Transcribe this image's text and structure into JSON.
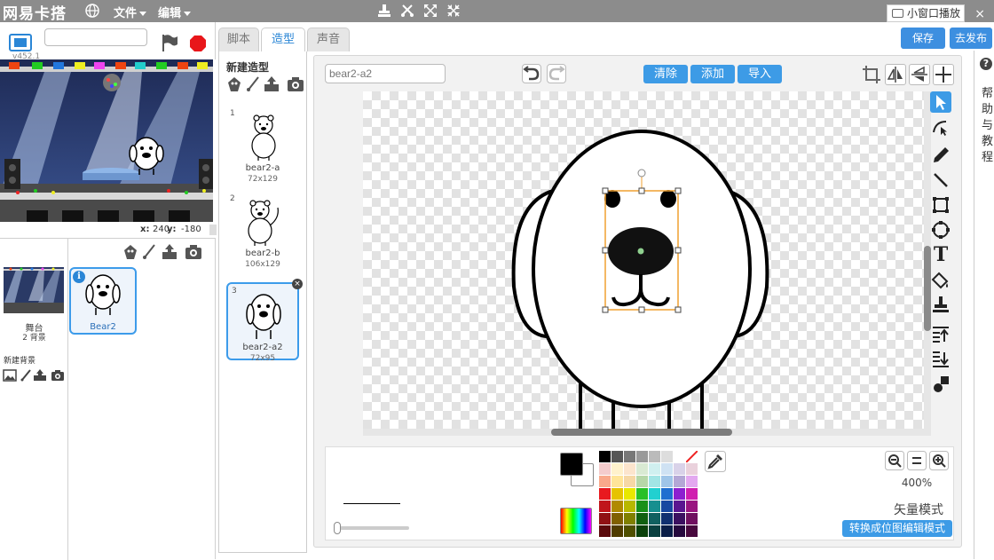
{
  "topbar": {
    "logo": "网易卡搭",
    "menus": [
      "文件",
      "编辑"
    ],
    "small_window": "小窗口播放",
    "close": "×"
  },
  "actions": {
    "save": "保存",
    "publish": "去发布"
  },
  "stage": {
    "version": "v452.1",
    "x_label": "x:",
    "x_value": "240",
    "y_label": "y:",
    "y_value": "-180"
  },
  "sprites": {
    "stage_name": "舞台",
    "bg_count": "2 背景",
    "new_bg_label": "新建背景",
    "items": [
      {
        "name": "Bear2",
        "info": "i"
      }
    ]
  },
  "tabs": [
    "脚本",
    "造型",
    "声音"
  ],
  "costumes": {
    "new_label": "新建造型",
    "items": [
      {
        "num": "1",
        "name": "bear2-a",
        "size": "72x129"
      },
      {
        "num": "2",
        "name": "bear2-b",
        "size": "106x129"
      },
      {
        "num": "3",
        "name": "bear2-a2",
        "size": "72x95"
      }
    ],
    "delete_glyph": "×"
  },
  "editor": {
    "costume_name_placeholder": "bear2-a2",
    "clear": "清除",
    "add": "添加",
    "import": "导入",
    "zoom_level": "400%",
    "mode": "矢量模式",
    "convert": "转换成位图编辑模式",
    "text_tool": "T"
  },
  "help": {
    "icon": "?",
    "text": "帮助与教程"
  },
  "colors": {
    "accent": "#3d9be6",
    "topbar": "#8c8c8c",
    "primary": "#000000",
    "secondary": "#ffffff"
  }
}
